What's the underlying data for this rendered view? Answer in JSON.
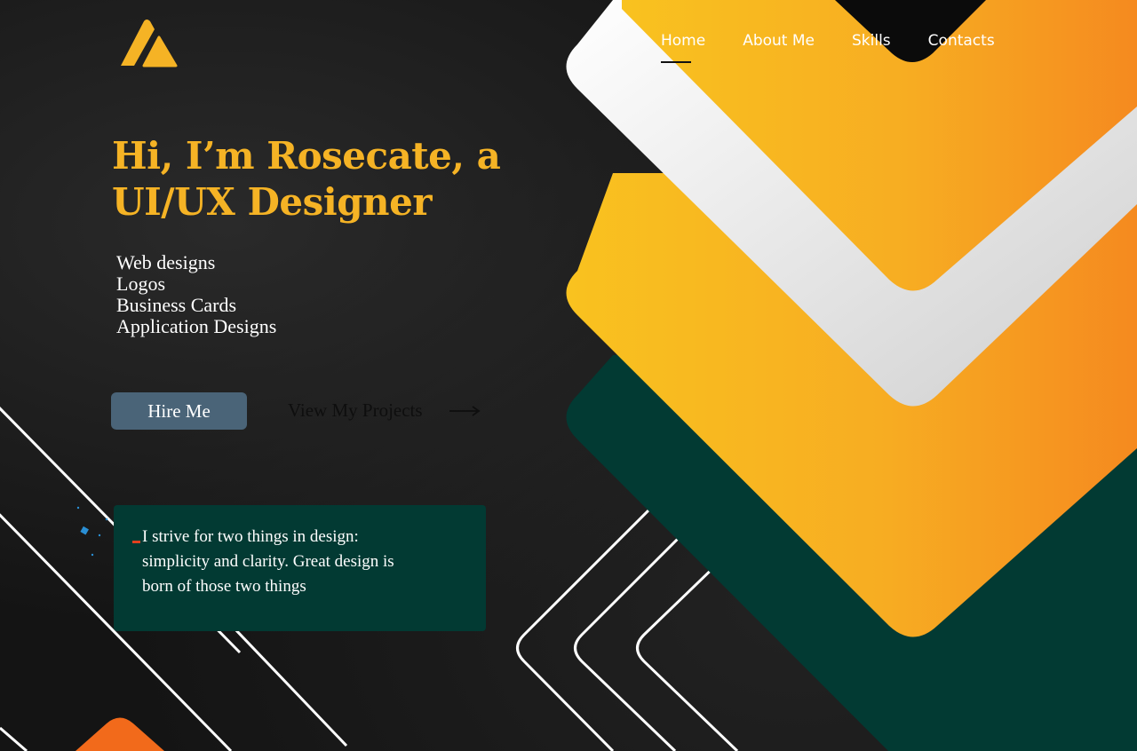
{
  "nav": {
    "items": [
      {
        "label": "Home",
        "active": true
      },
      {
        "label": "About Me",
        "active": false
      },
      {
        "label": "Skills",
        "active": false
      },
      {
        "label": "Contacts",
        "active": false
      }
    ]
  },
  "hero": {
    "title_line1": "Hi, I’m Rosecate, a",
    "title_line2": "UI/UX Designer",
    "services": [
      "Web designs",
      "Logos",
      "Business Cards",
      "Application Designs"
    ]
  },
  "actions": {
    "hire_label": "Hire Me",
    "view_projects_label": "View My Projects"
  },
  "quote": {
    "line1": "I strive for two things in design:",
    "line2": "simplicity and clarity. Great design is",
    "line3": "born of those two things"
  },
  "colors": {
    "accent": "#f5b325",
    "orange": "#f7941d",
    "dark_green": "#023a33",
    "button": "#4a6478",
    "background": "#151515"
  },
  "icons": {
    "logo": "triangle-logo-icon",
    "arrow": "arrow-right-icon"
  }
}
